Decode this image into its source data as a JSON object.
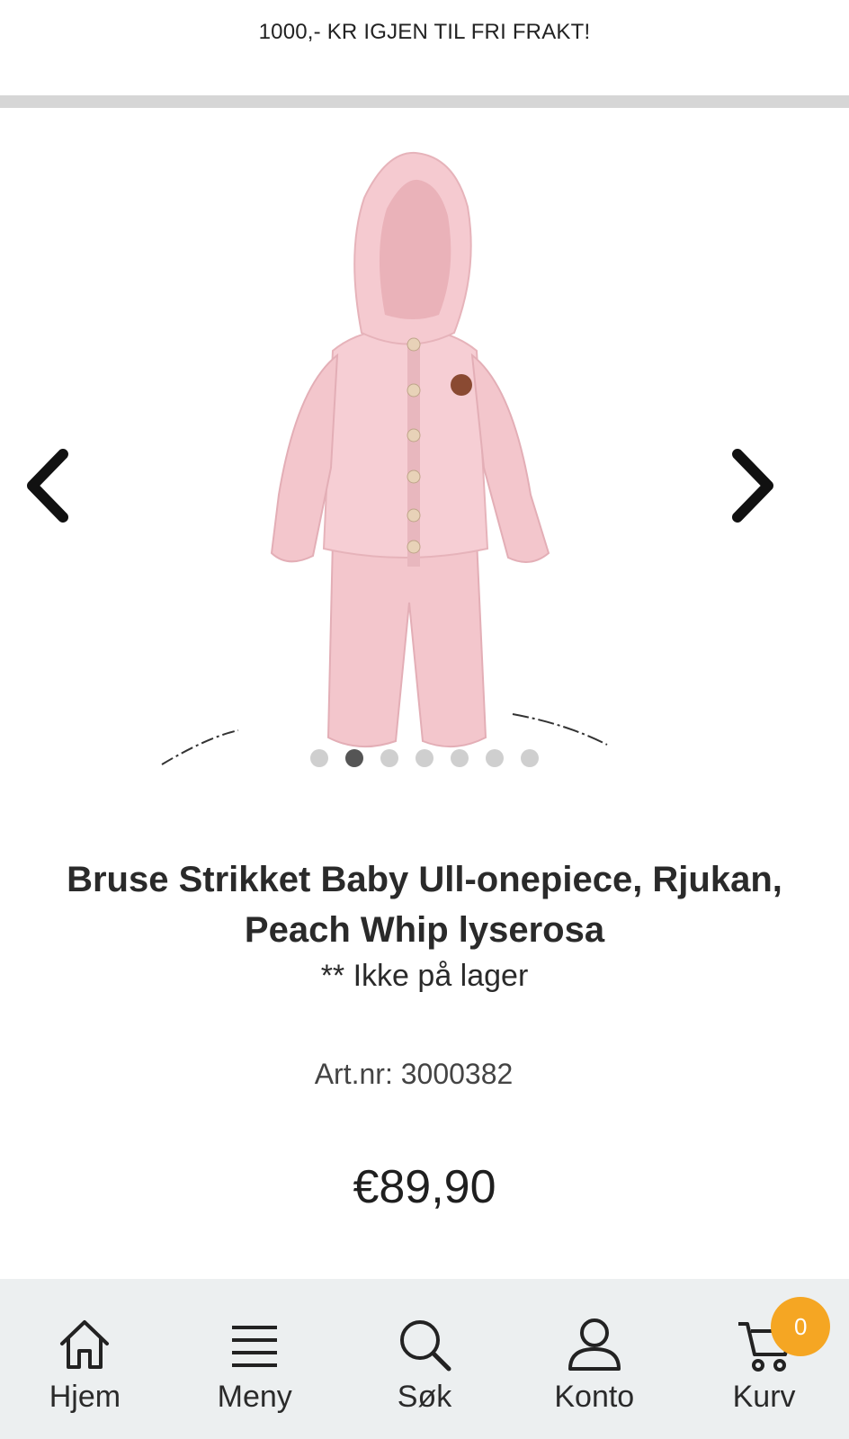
{
  "promo": {
    "text": "1000,- KR IGJEN TIL FRI FRAKT!"
  },
  "carousel": {
    "image_icon": "product-photo-pink-knit-onepiece",
    "prev_icon": "chevron-left-icon",
    "next_icon": "chevron-right-icon",
    "dot_count": 7,
    "active_dot": 2
  },
  "product": {
    "title": "Bruse Strikket Baby Ull-onepiece, Rjukan, Peach Whip lyserosa",
    "stock": "** Ikke på lager",
    "artnr": "Art.nr: 3000382",
    "price": "€89,90"
  },
  "nav": {
    "items": [
      {
        "label": "Hjem",
        "icon": "home-icon"
      },
      {
        "label": "Meny",
        "icon": "menu-icon"
      },
      {
        "label": "Søk",
        "icon": "search-icon"
      },
      {
        "label": "Konto",
        "icon": "user-icon"
      },
      {
        "label": "Kurv",
        "icon": "cart-icon"
      }
    ],
    "cart_count": "0"
  },
  "colors": {
    "badge": "#f5a623",
    "nav_bg": "#eceff0",
    "product": "#f4c9cf"
  }
}
